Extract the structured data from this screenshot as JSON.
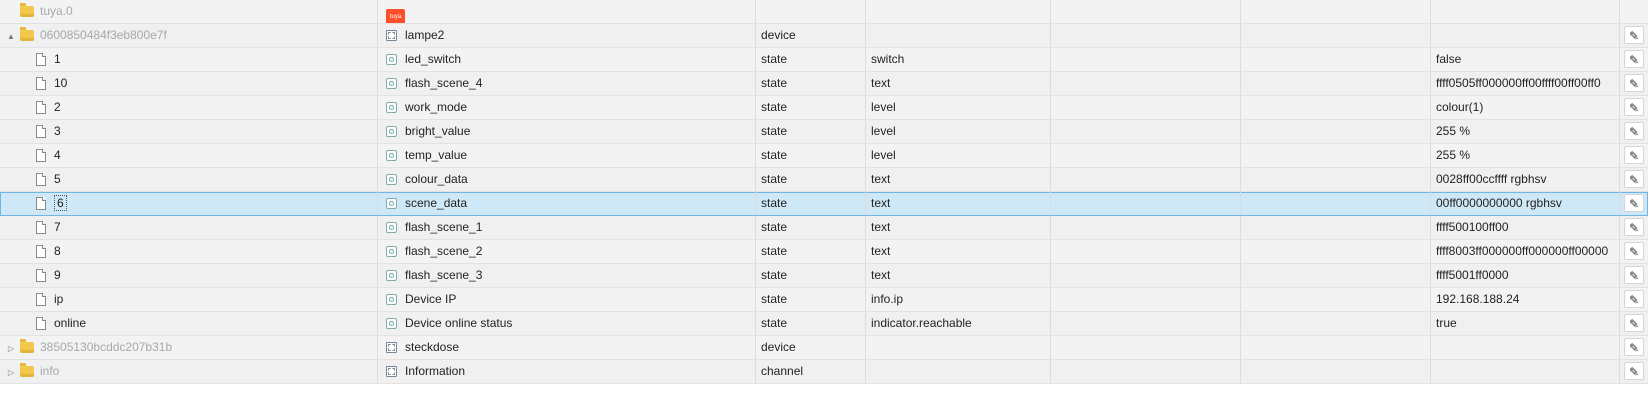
{
  "rows": [
    {
      "indent": 0,
      "toggle": "",
      "icon": "folder",
      "id": "tuya.0",
      "name_icon": "tuya-logo",
      "name": "",
      "type": "",
      "role": "",
      "value": "",
      "dim": true,
      "edit": false
    },
    {
      "indent": 1,
      "toggle": "▲",
      "icon": "folder",
      "id": "0600850484f3eb800e7f",
      "name_icon": "device-icon",
      "name": "lampe2",
      "type": "device",
      "role": "",
      "value": "",
      "dim": true,
      "edit": true
    },
    {
      "indent": 2,
      "toggle": "",
      "icon": "file",
      "id": "1",
      "name_icon": "state-icon",
      "name": "led_switch",
      "type": "state",
      "role": "switch",
      "value": "false",
      "edit": true
    },
    {
      "indent": 2,
      "toggle": "",
      "icon": "file",
      "id": "10",
      "name_icon": "state-icon",
      "name": "flash_scene_4",
      "type": "state",
      "role": "text",
      "value": "ffff0505ff000000ff00ffff00ff00ff0",
      "edit": true
    },
    {
      "indent": 2,
      "toggle": "",
      "icon": "file",
      "id": "2",
      "name_icon": "state-icon",
      "name": "work_mode",
      "type": "state",
      "role": "level",
      "value": "colour(1)",
      "edit": true
    },
    {
      "indent": 2,
      "toggle": "",
      "icon": "file",
      "id": "3",
      "name_icon": "state-icon",
      "name": "bright_value",
      "type": "state",
      "role": "level",
      "value": "255 %",
      "edit": true
    },
    {
      "indent": 2,
      "toggle": "",
      "icon": "file",
      "id": "4",
      "name_icon": "state-icon",
      "name": "temp_value",
      "type": "state",
      "role": "level",
      "value": "255 %",
      "edit": true
    },
    {
      "indent": 2,
      "toggle": "",
      "icon": "file",
      "id": "5",
      "name_icon": "state-icon",
      "name": "colour_data",
      "type": "state",
      "role": "text",
      "value": "0028ff00ccffff rgbhsv",
      "edit": true
    },
    {
      "indent": 2,
      "toggle": "",
      "icon": "file",
      "id": "6",
      "name_icon": "state-icon",
      "name": "scene_data",
      "type": "state",
      "role": "text",
      "value": "00ff0000000000 rgbhsv",
      "edit": true,
      "selected": true
    },
    {
      "indent": 2,
      "toggle": "",
      "icon": "file",
      "id": "7",
      "name_icon": "state-icon",
      "name": "flash_scene_1",
      "type": "state",
      "role": "text",
      "value": "ffff500100ff00",
      "edit": true
    },
    {
      "indent": 2,
      "toggle": "",
      "icon": "file",
      "id": "8",
      "name_icon": "state-icon",
      "name": "flash_scene_2",
      "type": "state",
      "role": "text",
      "value": "ffff8003ff000000ff000000ff00000",
      "edit": true
    },
    {
      "indent": 2,
      "toggle": "",
      "icon": "file",
      "id": "9",
      "name_icon": "state-icon",
      "name": "flash_scene_3",
      "type": "state",
      "role": "text",
      "value": "ffff5001ff0000",
      "edit": true
    },
    {
      "indent": 2,
      "toggle": "",
      "icon": "file",
      "id": "ip",
      "name_icon": "state-icon",
      "name": "Device IP",
      "type": "state",
      "role": "info.ip",
      "value": "192.168.188.24",
      "edit": true
    },
    {
      "indent": 2,
      "toggle": "",
      "icon": "file",
      "id": "online",
      "name_icon": "state-icon",
      "name": "Device online status",
      "type": "state",
      "role": "indicator.reachable",
      "value": "true",
      "edit": true
    },
    {
      "indent": 1,
      "toggle": "▷",
      "icon": "folder",
      "id": "38505130bcddc207b31b",
      "name_icon": "device-icon",
      "name": "steckdose",
      "type": "device",
      "role": "",
      "value": "",
      "dim": true,
      "edit": true
    },
    {
      "indent": 1,
      "toggle": "▷",
      "icon": "folder",
      "id": "info",
      "name_icon": "device-icon",
      "name": "Information",
      "type": "channel",
      "role": "",
      "value": "",
      "dim": true,
      "edit": true
    }
  ],
  "tuya_logo_text": "tuya",
  "edit_icon": "✎"
}
